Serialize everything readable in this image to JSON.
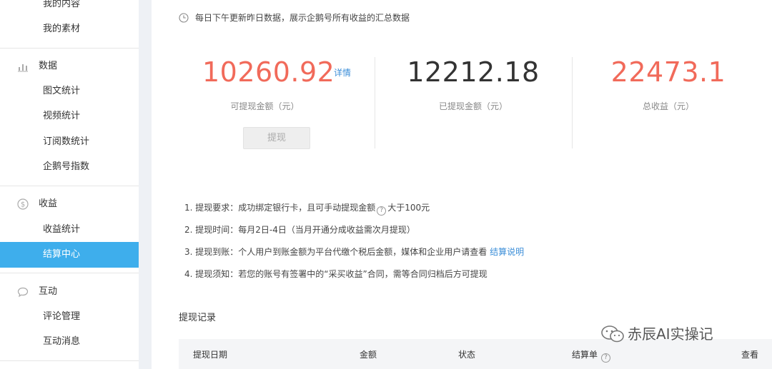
{
  "sidebar": {
    "top_items": [
      "我的内容",
      "我的素材"
    ],
    "groups": [
      {
        "title": "数据",
        "icon": "bar-chart-icon",
        "items": [
          "图文统计",
          "视频统计",
          "订阅数统计",
          "企鹅号指数"
        ]
      },
      {
        "title": "收益",
        "icon": "dollar-icon",
        "items": [
          "收益统计",
          "结算中心"
        ]
      },
      {
        "title": "互动",
        "icon": "comment-icon",
        "items": [
          "评论管理",
          "互动消息"
        ]
      }
    ],
    "active_item": "结算中心",
    "active_color": "#3eaeec"
  },
  "notice": "每日下午更新昨日数据，展示企鹅号所有收益的汇总数据",
  "stats": {
    "withdrawable": {
      "amount": "10260.92",
      "label": "可提现金额（元）",
      "detail": "详情"
    },
    "withdrawn": {
      "amount": "12212.18",
      "label": "已提现金额（元）"
    },
    "total": {
      "amount": "22473.1",
      "label": "总收益（元）"
    }
  },
  "withdraw_button": "提现",
  "rules": {
    "r1_prefix": "1. 提现要求：成功绑定银行卡，且可手动提现金额",
    "r1_suffix": "大于100元",
    "r2": "2. 提现时间：每月2日-4日（当月开通分成收益需次月提现）",
    "r3_prefix": "3. 提现到账：个人用户到账金额为平台代缴个税后金额，媒体和企业用户请查看",
    "r3_link": "结算说明",
    "r4": "4. 提现须知：若您的账号有签署中的“采买收益”合同，需等合同归档后方可提现"
  },
  "records": {
    "title": "提现记录",
    "columns": [
      "提现日期",
      "金额",
      "状态",
      "结算单",
      "查看"
    ]
  },
  "watermark": "赤辰AI实操记",
  "colors": {
    "accent_red": "#f16a5a",
    "link_blue": "#3b8ed8"
  }
}
